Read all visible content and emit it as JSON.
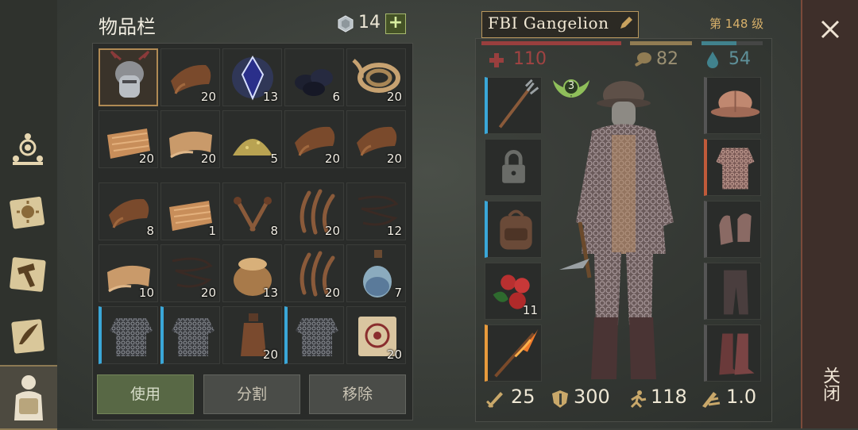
{
  "inventory": {
    "title": "物品栏",
    "currency_count": "14",
    "plus_label": "+",
    "slots": [
      {
        "icon": "demon-helmet-icon",
        "count": ""
      },
      {
        "icon": "leather-icon",
        "count": "20"
      },
      {
        "icon": "crystal-icon",
        "count": "13"
      },
      {
        "icon": "coal-icon",
        "count": "6"
      },
      {
        "icon": "rope-icon",
        "count": "20"
      },
      {
        "icon": "cloth-icon",
        "count": "20"
      },
      {
        "icon": "leather-roll-icon",
        "count": "20"
      },
      {
        "icon": "sulfur-icon",
        "count": "5"
      },
      {
        "icon": "leather-icon",
        "count": "20"
      },
      {
        "icon": "leather-icon",
        "count": "20"
      },
      {
        "icon": "leather-icon",
        "count": "8"
      },
      {
        "icon": "cloth-icon",
        "count": "1"
      },
      {
        "icon": "nails-icon",
        "count": "8"
      },
      {
        "icon": "fiber-icon",
        "count": "20"
      },
      {
        "icon": "wire-icon",
        "count": "12"
      },
      {
        "icon": "leather-roll-icon",
        "count": "10"
      },
      {
        "icon": "wire-icon",
        "count": "20"
      },
      {
        "icon": "sack-icon",
        "count": "13"
      },
      {
        "icon": "fiber-icon",
        "count": "20"
      },
      {
        "icon": "potion-icon",
        "count": "7"
      },
      {
        "icon": "chainmail-icon",
        "count": ""
      },
      {
        "icon": "chainmail-icon",
        "count": ""
      },
      {
        "icon": "flask-icon",
        "count": "20"
      },
      {
        "icon": "chainmail-icon",
        "count": ""
      },
      {
        "icon": "scroll-icon",
        "count": "20"
      }
    ],
    "buttons": {
      "use": "使用",
      "split": "分割",
      "remove": "移除"
    }
  },
  "character": {
    "name": "FBI Gangelion",
    "level": "第 148 级",
    "health": "110",
    "food": "82",
    "water": "54",
    "rank_badge": "3",
    "left_slots": [
      {
        "icon": "pitchfork-icon",
        "count": ""
      },
      {
        "icon": "lock-icon",
        "count": ""
      },
      {
        "icon": "backpack-icon",
        "count": ""
      },
      {
        "icon": "berries-icon",
        "count": "11"
      },
      {
        "icon": "torch-icon",
        "count": ""
      }
    ],
    "right_slots": [
      {
        "icon": "helmet-icon"
      },
      {
        "icon": "chainmail-shirt-icon"
      },
      {
        "icon": "gloves-icon"
      },
      {
        "icon": "pants-icon"
      },
      {
        "icon": "boots-icon"
      }
    ],
    "attack": "25",
    "armor": "300",
    "speed": "118",
    "weight": "1.0"
  },
  "close": {
    "label": "关闭"
  },
  "colors": {
    "health": "#d64a4a",
    "food": "#c9a86a",
    "water": "#4fb1c4",
    "accent_blue": "#3aa7d8",
    "accent_orange": "#e89a3c"
  }
}
